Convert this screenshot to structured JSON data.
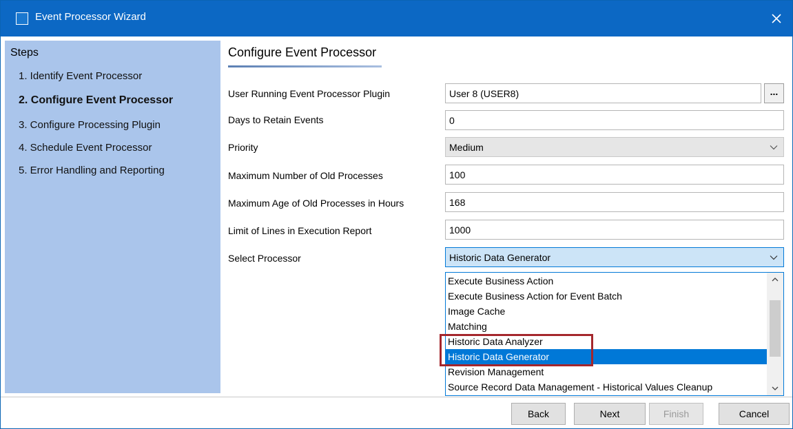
{
  "window": {
    "title": "Event Processor Wizard",
    "close_glyph": "✕"
  },
  "steps": {
    "title": "Steps",
    "items": [
      {
        "label": "1. Identify Event Processor",
        "active": false
      },
      {
        "label": "2. Configure Event Processor",
        "active": true
      },
      {
        "label": "3. Configure Processing Plugin",
        "active": false
      },
      {
        "label": "4. Schedule Event Processor",
        "active": false
      },
      {
        "label": "5. Error Handling and Reporting",
        "active": false
      }
    ]
  },
  "main": {
    "title": "Configure Event Processor",
    "fields": {
      "user_plugin": {
        "label": "User Running Event Processor Plugin",
        "value": "User 8 (USER8)",
        "browse_label": "..."
      },
      "days_retain": {
        "label": "Days to Retain Events",
        "value": "0"
      },
      "priority": {
        "label": "Priority",
        "value": "Medium"
      },
      "max_old_processes": {
        "label": "Maximum Number of Old Processes",
        "value": "100"
      },
      "max_age_hours": {
        "label": "Maximum Age of Old Processes in Hours",
        "value": "168"
      },
      "limit_lines": {
        "label": "Limit of Lines in Execution Report",
        "value": "1000"
      },
      "select_processor": {
        "label": "Select Processor",
        "value": "Historic Data Generator"
      }
    },
    "processor_options": [
      "Execute Business Action",
      "Execute Business Action for Event Batch",
      "Image Cache",
      "Matching",
      "Historic Data Analyzer",
      "Historic Data Generator",
      "Revision Management",
      "Source Record Data Management - Historical Values Cleanup"
    ],
    "selected_option_index": 5
  },
  "footer": {
    "back": "Back",
    "next": "Next",
    "finish": "Finish",
    "cancel": "Cancel"
  },
  "colors": {
    "titlebar": "#0c68c4",
    "steps_panel": "#aac5eb",
    "selection": "#0078d7",
    "highlight_box": "#a4262c"
  }
}
